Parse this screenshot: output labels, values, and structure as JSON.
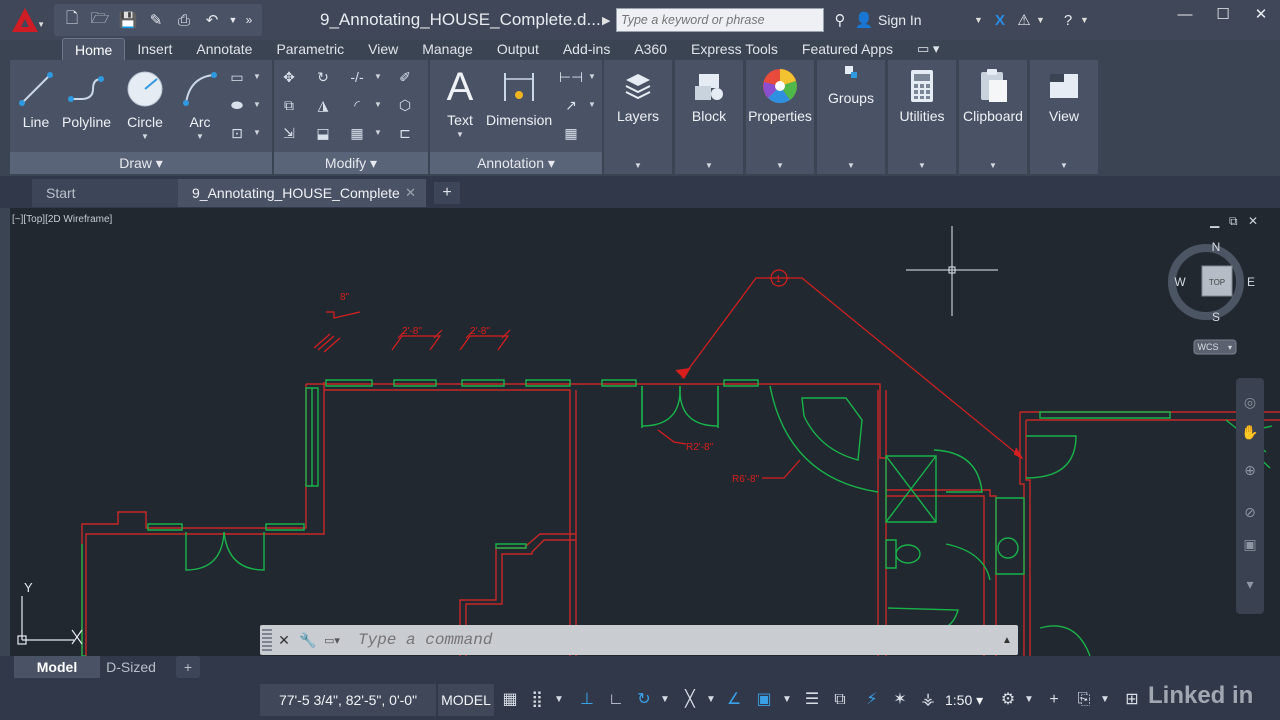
{
  "titlebar": {
    "doc_title": "9_Annotating_HOUSE_Complete.d...",
    "search_placeholder": "Type a keyword or phrase",
    "sign_in": "Sign In"
  },
  "ribbon_tabs": [
    "Home",
    "Insert",
    "Annotate",
    "Parametric",
    "View",
    "Manage",
    "Output",
    "Add-ins",
    "A360",
    "Express Tools",
    "Featured Apps"
  ],
  "draw_panel": {
    "title": "Draw",
    "line": "Line",
    "polyline": "Polyline",
    "circle": "Circle",
    "arc": "Arc"
  },
  "modify_panel": {
    "title": "Modify"
  },
  "annotation_panel": {
    "title": "Annotation",
    "text": "Text",
    "dimension": "Dimension"
  },
  "group_panels": {
    "layers": "Layers",
    "block": "Block",
    "properties": "Properties",
    "groups": "Groups",
    "utilities": "Utilities",
    "clipboard": "Clipboard",
    "view": "View"
  },
  "file_tabs": {
    "start": "Start",
    "active": "9_Annotating_HOUSE_Complete"
  },
  "viewport": {
    "label": "[−][Top][2D Wireframe]"
  },
  "viewcube": {
    "n": "N",
    "s": "S",
    "e": "E",
    "w": "W",
    "face": "TOP",
    "wcs": "WCS"
  },
  "drawing_annotations": {
    "tag": "1",
    "dim_a": "2'-8\"",
    "dim_b": "2'-8\"",
    "dim_c": "8\"",
    "dim_d": "R2'-8\"",
    "dim_e": "R6'-8\""
  },
  "ucs": {
    "y": "Y"
  },
  "command_line": {
    "placeholder": "Type a command"
  },
  "layout_tabs": {
    "model": "Model",
    "sheet": "D-Sized"
  },
  "statusbar": {
    "coords": "77'-5 3/4\", 82'-5\", 0'-0\"",
    "model": "MODEL",
    "scale": "1:50"
  },
  "colors": {
    "wall_red": "#c62828",
    "wall_green": "#19b34a",
    "annotation_red": "#d81f1f",
    "background": "#212830"
  },
  "watermark": "Linked in"
}
